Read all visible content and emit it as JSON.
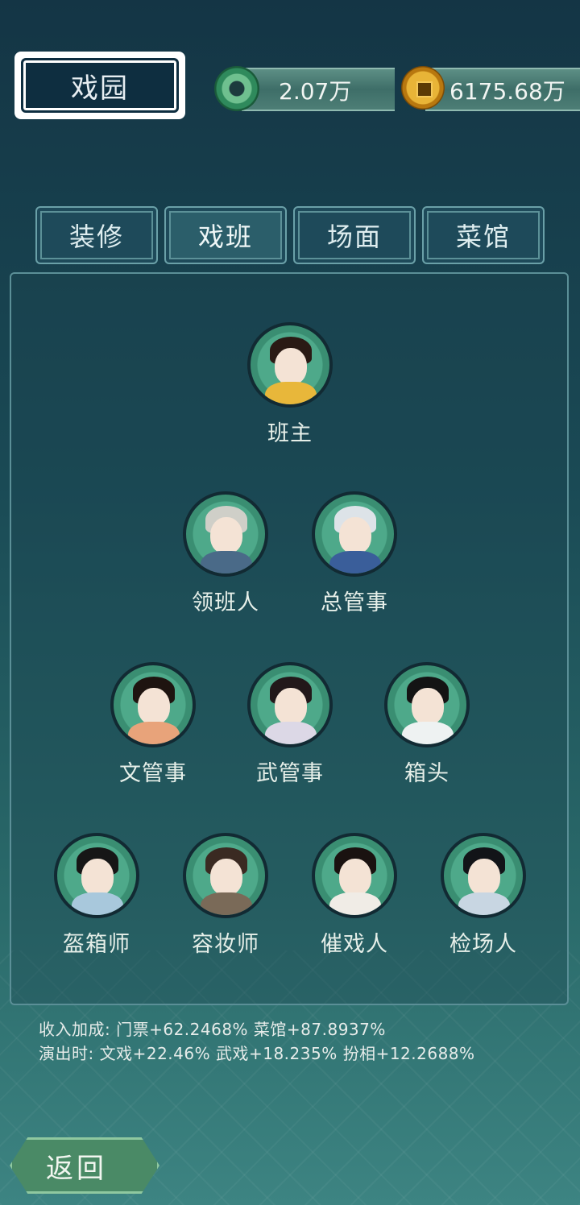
{
  "header": {
    "title": "戏园",
    "jade_amount": "2.07万",
    "coin_amount": "6175.68万"
  },
  "tabs": [
    {
      "label": "装修"
    },
    {
      "label": "戏班"
    },
    {
      "label": "场面"
    },
    {
      "label": "菜馆"
    }
  ],
  "troupe": {
    "leader": {
      "label": "班主"
    },
    "row2": [
      {
        "label": "领班人"
      },
      {
        "label": "总管事"
      }
    ],
    "row3": [
      {
        "label": "文管事"
      },
      {
        "label": "武管事"
      },
      {
        "label": "箱头"
      }
    ],
    "row4": [
      {
        "label": "盔箱师"
      },
      {
        "label": "容妆师"
      },
      {
        "label": "催戏人"
      },
      {
        "label": "检场人"
      }
    ]
  },
  "bonus": {
    "line1": "收入加成: 门票+62.2468% 菜馆+87.8937%",
    "line2": "演出时: 文戏+22.46% 武戏+18.235% 扮相+12.2688%"
  },
  "back_button": {
    "label": "返回"
  },
  "colors": {
    "panel_border": "#5b8f97",
    "avatar_bg": "#4ea98a",
    "text": "#e6efe9"
  }
}
